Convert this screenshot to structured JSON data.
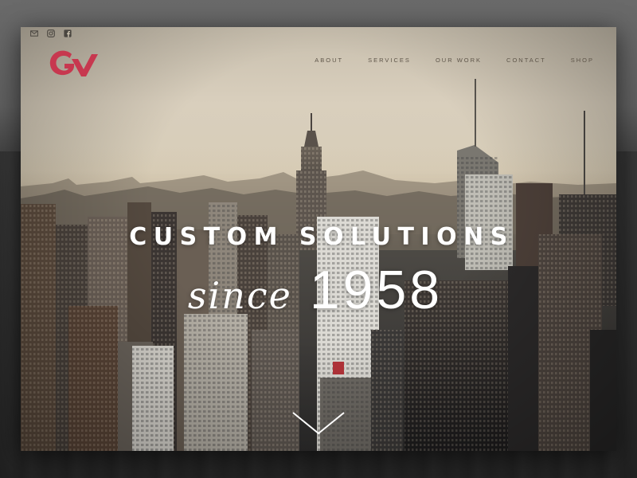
{
  "header": {
    "social_icons": [
      "mail-icon",
      "instagram-icon",
      "facebook-icon"
    ],
    "logo": {
      "text": "GV",
      "color": "#c7384f"
    },
    "nav": [
      {
        "label": "ABOUT"
      },
      {
        "label": "SERVICES"
      },
      {
        "label": "OUR WORK"
      },
      {
        "label": "CONTACT"
      },
      {
        "label": "SHOP"
      }
    ]
  },
  "hero": {
    "title": "CUSTOM SOLUTIONS",
    "since": "since",
    "year": "1958",
    "scroll_icon": "chevron-down-icon"
  },
  "colors": {
    "brand": "#c7384f",
    "nav_text": "#5e5549",
    "hero_text": "#ffffff"
  }
}
